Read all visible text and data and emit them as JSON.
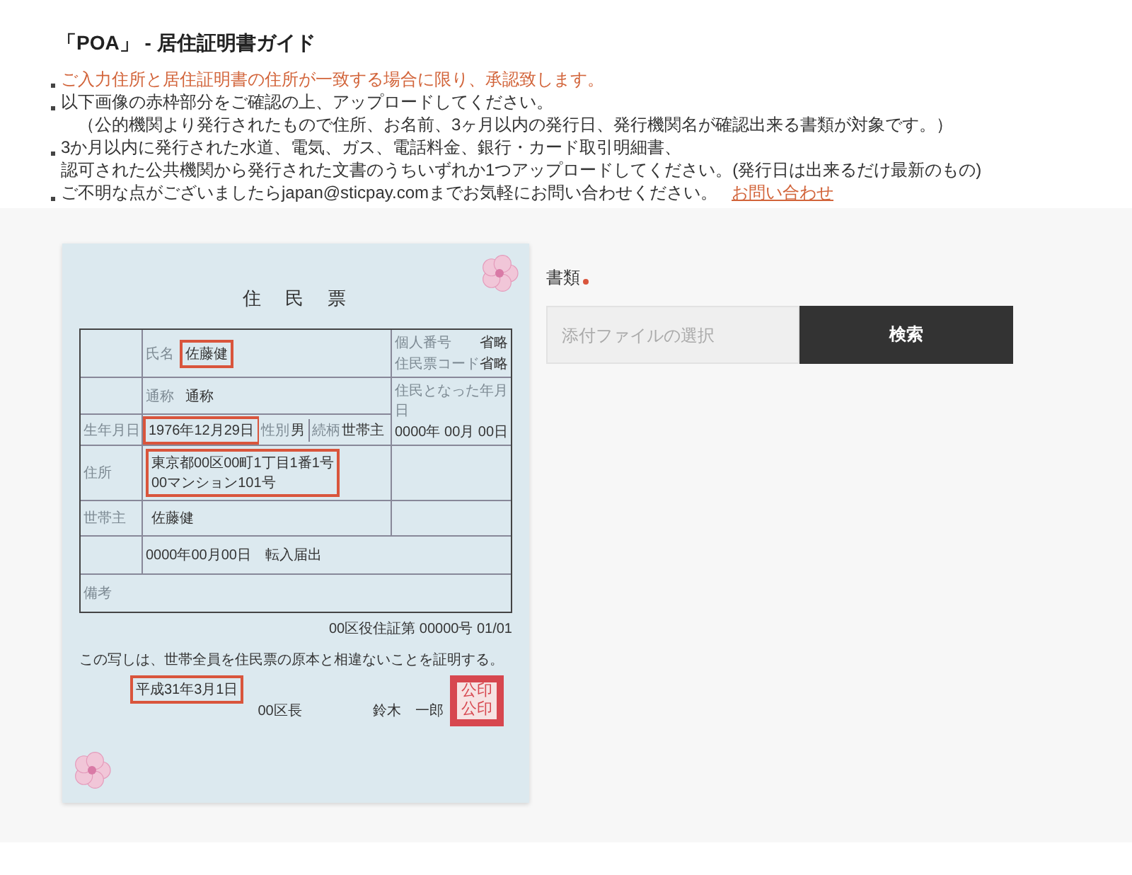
{
  "title": "「POA」 - 居住証明書ガイド",
  "notes": [
    {
      "kind": "warning",
      "lines": [
        "ご入力住所と居住証明書の住所が一致する場合に限り、承認致します。"
      ]
    },
    {
      "kind": "normal",
      "lines": [
        "以下画像の赤枠部分をご確認の上、アップロードしてください。",
        "（公的機関より発行されたもので住所、お名前、3ヶ月以内の発行日、発行機関名が確認出来る書類が対象です。）"
      ]
    },
    {
      "kind": "normal",
      "lines": [
        "3か月以内に発行された水道、電気、ガス、電話料金、銀行・カード取引明細書、",
        "認可された公共機関から発行された文書のうちいずれか1つアップロードしてください。(発行日は出来るだけ最新のもの)"
      ]
    },
    {
      "kind": "normal",
      "lines": [
        "ご不明な点がございましたらjapan@sticpay.comまでお気軽にお問い合わせください。"
      ],
      "link": "お問い合わせ"
    }
  ],
  "document": {
    "heading": "住　民　票",
    "name": {
      "label": "氏名",
      "value": "佐藤健",
      "highlighted": true
    },
    "alias": {
      "label": "通称",
      "value": "通称",
      "highlighted": false
    },
    "birth": {
      "label": "生年月日",
      "value": "1976年12月29日",
      "highlighted": true
    },
    "sex": {
      "label": "性別",
      "value": "男"
    },
    "relation": {
      "label": "続柄",
      "value": "世帯主"
    },
    "address": {
      "label": "住所",
      "lines": [
        "東京都00区00町1丁目1番1号",
        "00マンション101号"
      ],
      "highlighted": true
    },
    "householder": {
      "label": "世帯主",
      "value": "佐藤健",
      "highlighted": false
    },
    "moved_in": "0000年00月00日　転入届出",
    "remarks": "備考",
    "ids": [
      {
        "label": "個人番号",
        "value": "省略"
      },
      {
        "label": "住民票コード",
        "value": "省略"
      }
    ],
    "resident_since": {
      "label": "住民となった年月日",
      "value": "0000年 00月 00日"
    },
    "serial": "00区役住証第 00000号 01/01",
    "certification": "この写しは、世帯全員を住民票の原本と相違ないことを証明する。",
    "issue_date": {
      "value": "平成31年3月1日",
      "highlighted": true
    },
    "issuer": "00区長",
    "mayor": "鈴木　一郎",
    "seal": [
      "公印",
      "公印"
    ]
  },
  "upload": {
    "label": "書類",
    "required": true,
    "placeholder": "添付ファイルの選択",
    "button": "検索"
  }
}
